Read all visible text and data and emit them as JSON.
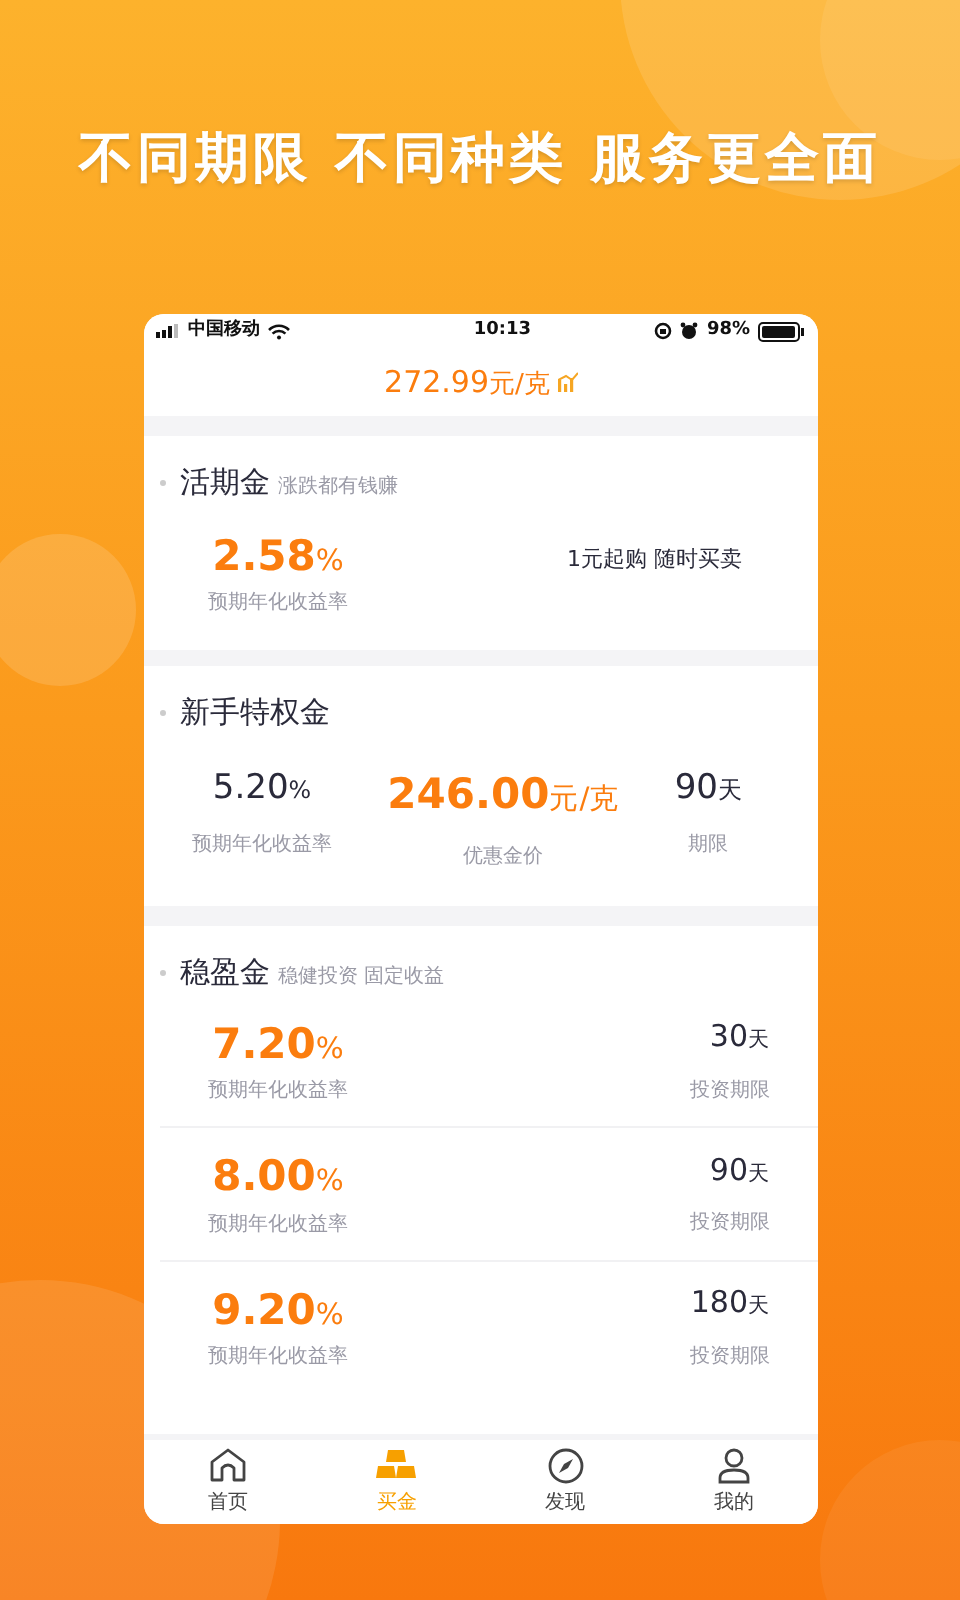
{
  "headline": "不同期限 不同种类 服务更全面",
  "status_bar": {
    "carrier": "中国移动",
    "time": "10:13",
    "battery": "98%"
  },
  "price_bar": {
    "price": "272.99",
    "unit": "元/克"
  },
  "current_gold": {
    "title": "活期金",
    "subtitle": "涨跌都有钱赚",
    "rate": "2.58",
    "rate_unit": "%",
    "rate_label": "预期年化收益率",
    "note": "1元起购 随时买卖"
  },
  "newbie_gold": {
    "title": "新手特权金",
    "items": [
      {
        "kind": "rate",
        "value": "5.20",
        "unit": "%",
        "label": "预期年化收益率"
      },
      {
        "kind": "price",
        "value": "246.00",
        "unit": "元/克",
        "label": "优惠金价"
      },
      {
        "kind": "term",
        "value": "90",
        "unit": "天",
        "label": "期限"
      }
    ]
  },
  "fixed_gold": {
    "title": "稳盈金",
    "subtitle": "稳健投资 固定收益",
    "rows": [
      {
        "rate": "7.20",
        "rate_unit": "%",
        "rate_label": "预期年化收益率",
        "term": "30",
        "term_unit": "天",
        "term_label": "投资期限"
      },
      {
        "rate": "8.00",
        "rate_unit": "%",
        "rate_label": "预期年化收益率",
        "term": "90",
        "term_unit": "天",
        "term_label": "投资期限"
      },
      {
        "rate": "9.20",
        "rate_unit": "%",
        "rate_label": "预期年化收益率",
        "term": "180",
        "term_unit": "天",
        "term_label": "投资期限"
      }
    ]
  },
  "tab_bar": [
    {
      "kind": "home",
      "label": "首页",
      "selected": false
    },
    {
      "kind": "gold",
      "label": "买金",
      "selected": true
    },
    {
      "kind": "discover",
      "label": "发现",
      "selected": false
    },
    {
      "kind": "profile",
      "label": "我的",
      "selected": false
    }
  ]
}
